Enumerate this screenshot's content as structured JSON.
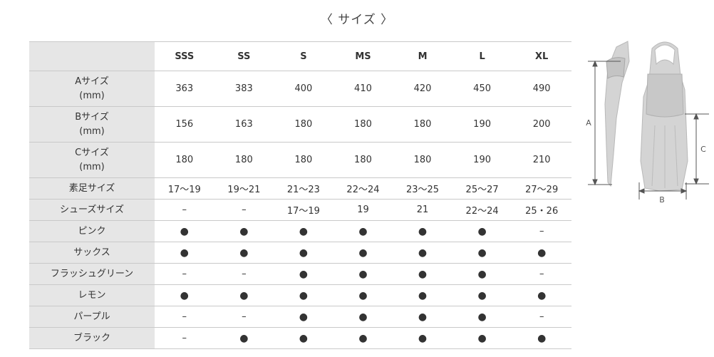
{
  "title": "〈 サイズ 〉",
  "table": {
    "columns": [
      "SSS",
      "SS",
      "S",
      "MS",
      "M",
      "L",
      "XL"
    ],
    "rows": [
      {
        "label": "Aサイズ\n(mm)",
        "cells": [
          "363",
          "383",
          "400",
          "410",
          "420",
          "450",
          "490"
        ]
      },
      {
        "label": "Bサイズ\n(mm)",
        "cells": [
          "156",
          "163",
          "180",
          "180",
          "180",
          "190",
          "200"
        ]
      },
      {
        "label": "Cサイズ\n(mm)",
        "cells": [
          "180",
          "180",
          "180",
          "180",
          "180",
          "190",
          "210"
        ]
      },
      {
        "label": "素足サイズ",
        "cells": [
          "17〜19",
          "19〜21",
          "21〜23",
          "22〜24",
          "23〜25",
          "25〜27",
          "27〜29"
        ]
      },
      {
        "label": "シューズサイズ",
        "cells": [
          "–",
          "–",
          "17〜19",
          "19",
          "21",
          "22〜24",
          "25・26"
        ]
      },
      {
        "label": "ピンク",
        "cells": [
          "●",
          "●",
          "●",
          "●",
          "●",
          "●",
          "–"
        ]
      },
      {
        "label": "サックス",
        "cells": [
          "●",
          "●",
          "●",
          "●",
          "●",
          "●",
          "●"
        ]
      },
      {
        "label": "フラッシュグリーン",
        "cells": [
          "–",
          "–",
          "●",
          "●",
          "●",
          "●",
          "–"
        ]
      },
      {
        "label": "レモン",
        "cells": [
          "●",
          "●",
          "●",
          "●",
          "●",
          "●",
          "●"
        ]
      },
      {
        "label": "パープル",
        "cells": [
          "–",
          "–",
          "●",
          "●",
          "●",
          "●",
          "–"
        ]
      },
      {
        "label": "ブラック",
        "cells": [
          "–",
          "●",
          "●",
          "●",
          "●",
          "●",
          "●"
        ]
      }
    ]
  },
  "diagram": {
    "label_a": "A",
    "label_b": "B",
    "label_c": "C"
  },
  "colors": {
    "label_bg": "#e6e6e6",
    "border": "#c9c9c9",
    "fin_fill": "#d4d4d4",
    "dimension_line": "#555555"
  }
}
